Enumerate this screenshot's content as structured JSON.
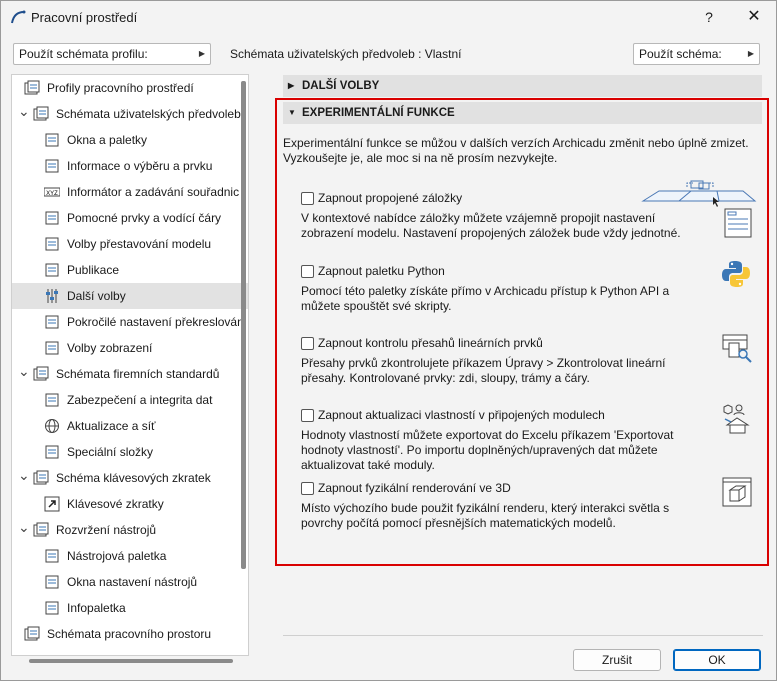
{
  "window": {
    "title": "Pracovní prostředí",
    "help_label": "?",
    "close_label": "✕"
  },
  "toolbar": {
    "profile_scheme_button": "Použít schémata profilu:",
    "center_text": "Schémata uživatelských předvoleb :  Vlastní",
    "apply_scheme_button": "Použít schéma:"
  },
  "tree": {
    "items": [
      {
        "label": "Profily pracovního prostředí",
        "icon": "profiles-icon"
      },
      {
        "label": "Schémata uživatelských předvoleb",
        "icon": "user-schemes-icon",
        "expanded": true
      },
      {
        "label": "Okna a paletky",
        "icon": "windows-palettes-icon"
      },
      {
        "label": "Informace o výběru a prvku",
        "icon": "selection-info-icon"
      },
      {
        "label": "Informátor a zadávání souřadnic",
        "icon": "xyz-icon"
      },
      {
        "label": "Pomocné prvky a vodící čáry",
        "icon": "guide-lines-icon"
      },
      {
        "label": "Volby přestavování modelu",
        "icon": "model-rebuild-icon"
      },
      {
        "label": "Publikace",
        "icon": "publication-icon"
      },
      {
        "label": "Další volby",
        "icon": "more-options-icon",
        "selected": true
      },
      {
        "label": "Pokročilé nastavení překreslován",
        "icon": "redraw-icon"
      },
      {
        "label": "Volby zobrazení",
        "icon": "display-options-icon"
      },
      {
        "label": "Schémata firemních standardů",
        "icon": "company-schemes-icon",
        "expanded": true
      },
      {
        "label": "Zabezpečení a integrita dat",
        "icon": "security-icon"
      },
      {
        "label": "Aktualizace a síť",
        "icon": "globe-icon"
      },
      {
        "label": "Speciální složky",
        "icon": "folders-icon"
      },
      {
        "label": "Schéma klávesových zkratek",
        "icon": "shortcut-schemes-icon",
        "expanded": true
      },
      {
        "label": "Klávesové zkratky",
        "icon": "shortcut-icon"
      },
      {
        "label": "Rozvržení nástrojů",
        "icon": "tool-layout-icon",
        "expanded": true
      },
      {
        "label": "Nástrojová paletka",
        "icon": "toolbox-icon"
      },
      {
        "label": "Okna nastavení nástrojů",
        "icon": "tool-settings-icon"
      },
      {
        "label": "Infopaletka",
        "icon": "infobox-icon"
      },
      {
        "label": "Schémata pracovního prostoru",
        "icon": "workspace-schemes-icon"
      }
    ]
  },
  "sections": {
    "more_options": "DALŠÍ VOLBY",
    "experimental": "EXPERIMENTÁLNÍ FUNKCE"
  },
  "intro_text": "Experimentální funkce se můžou v dalších verzích Archicadu změnit nebo úplně zmizet. Vyzkoušejte je, ale moc si na ně prosím nezvykejte.",
  "options": [
    {
      "label": "Zapnout propojené záložky",
      "desc": "V kontextové nabídce záložky můžete vzájemně propojit nastavení zobrazení modelu. Nastavení propojených záložek bude vždy jednotné.",
      "checked": false,
      "icon": "linked-tabs-icon"
    },
    {
      "label": "Zapnout paletku Python",
      "desc": "Pomocí této paletky získáte přímo v Archicadu přístup k Python API a můžete spouštět své skripty.",
      "checked": false,
      "icon": "python-icon"
    },
    {
      "label": "Zapnout kontrolu přesahů lineárních prvků",
      "desc": "Přesahy prvků zkontrolujete příkazem Úpravy > Zkontrolovat lineární přesahy. Kontrolované prvky: zdi, sloupy, trámy a čáry.",
      "checked": false,
      "icon": "overlap-check-icon"
    },
    {
      "label": "Zapnout aktualizaci vlastností v připojených modulech",
      "desc": "Hodnoty vlastností můžete exportovat do Excelu příkazem 'Exportovat hodnoty vlastností'. Po importu doplněných/upravených dat můžete aktualizovat také moduly.",
      "checked": false,
      "icon": "property-update-icon"
    },
    {
      "label": "Zapnout fyzikální renderování ve 3D",
      "desc": "Místo výchozího bude použit fyzikální renderu, který interakci světla s povrchy počítá pomocí přesnějších matematických modelů.",
      "checked": false,
      "icon": "render-3d-icon"
    }
  ],
  "footer": {
    "cancel_label": "Zrušit",
    "ok_label": "OK"
  }
}
